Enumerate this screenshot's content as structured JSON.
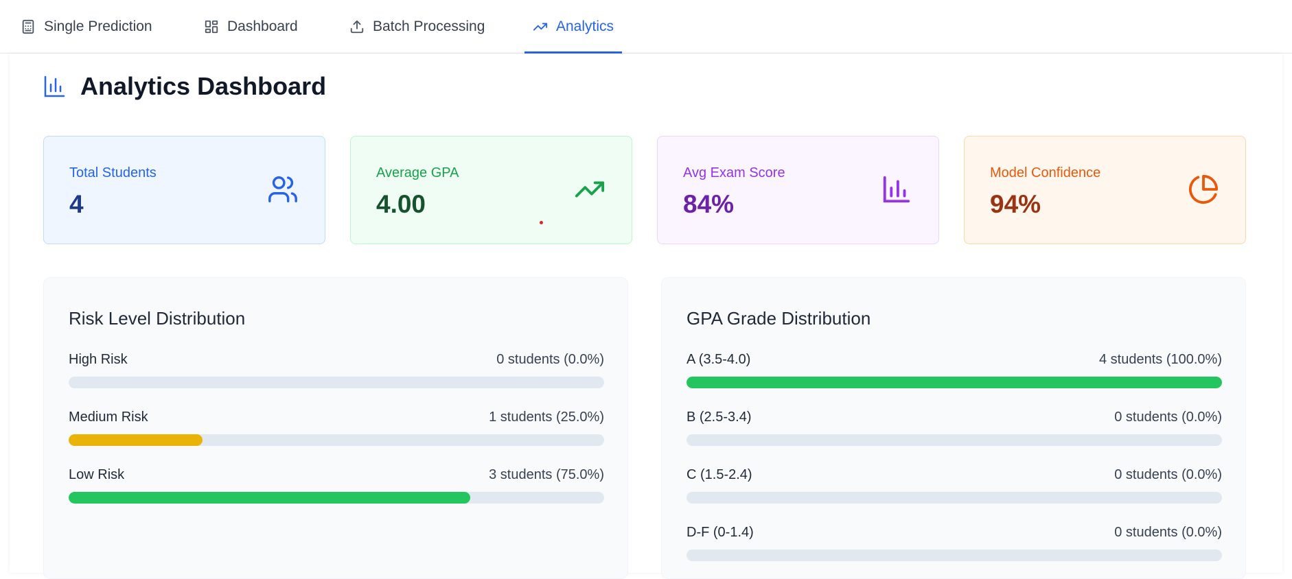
{
  "nav": {
    "tabs": [
      {
        "label": "Single Prediction",
        "icon": "calculator-icon"
      },
      {
        "label": "Dashboard",
        "icon": "grid-icon"
      },
      {
        "label": "Batch Processing",
        "icon": "upload-icon"
      },
      {
        "label": "Analytics",
        "icon": "trending-up-icon",
        "active": true
      }
    ]
  },
  "header": {
    "title": "Analytics Dashboard",
    "icon": "bar-chart-icon"
  },
  "stats": [
    {
      "label": "Total Students",
      "value": "4",
      "icon": "users-icon"
    },
    {
      "label": "Average GPA",
      "value": "4.00",
      "icon": "trending-up-icon"
    },
    {
      "label": "Avg Exam Score",
      "value": "84%",
      "icon": "bar-chart-icon"
    },
    {
      "label": "Model Confidence",
      "value": "94%",
      "icon": "pie-chart-icon"
    }
  ],
  "risk": {
    "title": "Risk Level Distribution",
    "rows": [
      {
        "label": "High Risk",
        "count": "0 students (0.0%)",
        "fraction": 0.0,
        "color": "#ef4444"
      },
      {
        "label": "Medium Risk",
        "count": "1 students (25.0%)",
        "fraction": 0.25,
        "color": "#eab308"
      },
      {
        "label": "Low Risk",
        "count": "3 students (75.0%)",
        "fraction": 0.75,
        "color": "#22c55e"
      }
    ]
  },
  "gpa": {
    "title": "GPA Grade Distribution",
    "rows": [
      {
        "label": "A (3.5-4.0)",
        "count": "4 students (100.0%)",
        "fraction": 1.0,
        "color": "#22c55e"
      },
      {
        "label": "B (2.5-3.4)",
        "count": "0 students (0.0%)",
        "fraction": 0.0,
        "color": "#3b82f6"
      },
      {
        "label": "C (1.5-2.4)",
        "count": "0 students (0.0%)",
        "fraction": 0.0,
        "color": "#eab308"
      },
      {
        "label": "D-F (0-1.4)",
        "count": "0 students (0.0%)",
        "fraction": 0.0,
        "color": "#ef4444"
      }
    ]
  },
  "colors": {
    "accent": "#2563eb"
  }
}
